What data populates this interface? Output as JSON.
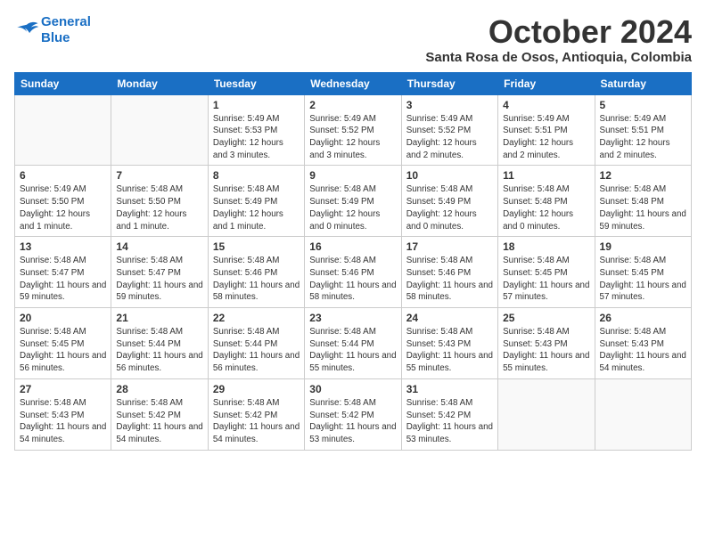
{
  "header": {
    "logo_line1": "General",
    "logo_line2": "Blue",
    "month_title": "October 2024",
    "subtitle": "Santa Rosa de Osos, Antioquia, Colombia"
  },
  "weekdays": [
    "Sunday",
    "Monday",
    "Tuesday",
    "Wednesday",
    "Thursday",
    "Friday",
    "Saturday"
  ],
  "weeks": [
    [
      {
        "day": "",
        "info": ""
      },
      {
        "day": "",
        "info": ""
      },
      {
        "day": "1",
        "info": "Sunrise: 5:49 AM\nSunset: 5:53 PM\nDaylight: 12 hours and 3 minutes."
      },
      {
        "day": "2",
        "info": "Sunrise: 5:49 AM\nSunset: 5:52 PM\nDaylight: 12 hours and 3 minutes."
      },
      {
        "day": "3",
        "info": "Sunrise: 5:49 AM\nSunset: 5:52 PM\nDaylight: 12 hours and 2 minutes."
      },
      {
        "day": "4",
        "info": "Sunrise: 5:49 AM\nSunset: 5:51 PM\nDaylight: 12 hours and 2 minutes."
      },
      {
        "day": "5",
        "info": "Sunrise: 5:49 AM\nSunset: 5:51 PM\nDaylight: 12 hours and 2 minutes."
      }
    ],
    [
      {
        "day": "6",
        "info": "Sunrise: 5:49 AM\nSunset: 5:50 PM\nDaylight: 12 hours and 1 minute."
      },
      {
        "day": "7",
        "info": "Sunrise: 5:48 AM\nSunset: 5:50 PM\nDaylight: 12 hours and 1 minute."
      },
      {
        "day": "8",
        "info": "Sunrise: 5:48 AM\nSunset: 5:49 PM\nDaylight: 12 hours and 1 minute."
      },
      {
        "day": "9",
        "info": "Sunrise: 5:48 AM\nSunset: 5:49 PM\nDaylight: 12 hours and 0 minutes."
      },
      {
        "day": "10",
        "info": "Sunrise: 5:48 AM\nSunset: 5:49 PM\nDaylight: 12 hours and 0 minutes."
      },
      {
        "day": "11",
        "info": "Sunrise: 5:48 AM\nSunset: 5:48 PM\nDaylight: 12 hours and 0 minutes."
      },
      {
        "day": "12",
        "info": "Sunrise: 5:48 AM\nSunset: 5:48 PM\nDaylight: 11 hours and 59 minutes."
      }
    ],
    [
      {
        "day": "13",
        "info": "Sunrise: 5:48 AM\nSunset: 5:47 PM\nDaylight: 11 hours and 59 minutes."
      },
      {
        "day": "14",
        "info": "Sunrise: 5:48 AM\nSunset: 5:47 PM\nDaylight: 11 hours and 59 minutes."
      },
      {
        "day": "15",
        "info": "Sunrise: 5:48 AM\nSunset: 5:46 PM\nDaylight: 11 hours and 58 minutes."
      },
      {
        "day": "16",
        "info": "Sunrise: 5:48 AM\nSunset: 5:46 PM\nDaylight: 11 hours and 58 minutes."
      },
      {
        "day": "17",
        "info": "Sunrise: 5:48 AM\nSunset: 5:46 PM\nDaylight: 11 hours and 58 minutes."
      },
      {
        "day": "18",
        "info": "Sunrise: 5:48 AM\nSunset: 5:45 PM\nDaylight: 11 hours and 57 minutes."
      },
      {
        "day": "19",
        "info": "Sunrise: 5:48 AM\nSunset: 5:45 PM\nDaylight: 11 hours and 57 minutes."
      }
    ],
    [
      {
        "day": "20",
        "info": "Sunrise: 5:48 AM\nSunset: 5:45 PM\nDaylight: 11 hours and 56 minutes."
      },
      {
        "day": "21",
        "info": "Sunrise: 5:48 AM\nSunset: 5:44 PM\nDaylight: 11 hours and 56 minutes."
      },
      {
        "day": "22",
        "info": "Sunrise: 5:48 AM\nSunset: 5:44 PM\nDaylight: 11 hours and 56 minutes."
      },
      {
        "day": "23",
        "info": "Sunrise: 5:48 AM\nSunset: 5:44 PM\nDaylight: 11 hours and 55 minutes."
      },
      {
        "day": "24",
        "info": "Sunrise: 5:48 AM\nSunset: 5:43 PM\nDaylight: 11 hours and 55 minutes."
      },
      {
        "day": "25",
        "info": "Sunrise: 5:48 AM\nSunset: 5:43 PM\nDaylight: 11 hours and 55 minutes."
      },
      {
        "day": "26",
        "info": "Sunrise: 5:48 AM\nSunset: 5:43 PM\nDaylight: 11 hours and 54 minutes."
      }
    ],
    [
      {
        "day": "27",
        "info": "Sunrise: 5:48 AM\nSunset: 5:43 PM\nDaylight: 11 hours and 54 minutes."
      },
      {
        "day": "28",
        "info": "Sunrise: 5:48 AM\nSunset: 5:42 PM\nDaylight: 11 hours and 54 minutes."
      },
      {
        "day": "29",
        "info": "Sunrise: 5:48 AM\nSunset: 5:42 PM\nDaylight: 11 hours and 54 minutes."
      },
      {
        "day": "30",
        "info": "Sunrise: 5:48 AM\nSunset: 5:42 PM\nDaylight: 11 hours and 53 minutes."
      },
      {
        "day": "31",
        "info": "Sunrise: 5:48 AM\nSunset: 5:42 PM\nDaylight: 11 hours and 53 minutes."
      },
      {
        "day": "",
        "info": ""
      },
      {
        "day": "",
        "info": ""
      }
    ]
  ]
}
